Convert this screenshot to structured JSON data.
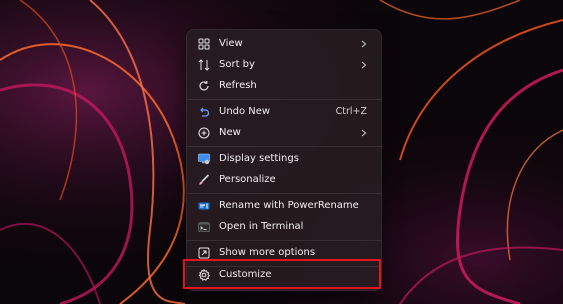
{
  "context_menu": {
    "items": [
      {
        "label": "View",
        "icon": "view-grid-icon",
        "submenu": true
      },
      {
        "label": "Sort by",
        "icon": "sort-icon",
        "submenu": true
      },
      {
        "label": "Refresh",
        "icon": "refresh-icon"
      },
      {
        "label": "Undo New",
        "icon": "undo-icon",
        "shortcut": "Ctrl+Z"
      },
      {
        "label": "New",
        "icon": "new-plus-icon",
        "submenu": true
      },
      {
        "label": "Display settings",
        "icon": "display-settings-icon"
      },
      {
        "label": "Personalize",
        "icon": "personalize-brush-icon"
      },
      {
        "label": "Rename with PowerRename",
        "icon": "powerrename-icon"
      },
      {
        "label": "Open in Terminal",
        "icon": "terminal-icon"
      },
      {
        "label": "Show more options",
        "icon": "show-more-options-icon"
      },
      {
        "label": "Customize",
        "icon": "gear-icon"
      }
    ]
  },
  "colors": {
    "highlight_border": "#e3141b",
    "menu_background": "#261c20",
    "text": "#f2eef0",
    "undo_icon_accent": "#6aa3ff"
  }
}
